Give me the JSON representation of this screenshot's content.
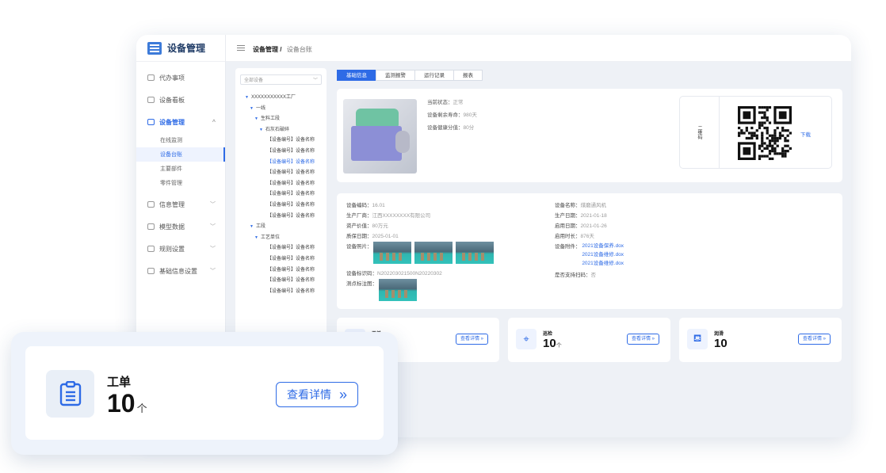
{
  "app": {
    "title": "设备管理"
  },
  "breadcrumb": {
    "parent": "设备管理 /",
    "current": "设备台账"
  },
  "sidebar": {
    "items": [
      {
        "label": "代办事项",
        "icon": "calendar-icon"
      },
      {
        "label": "设备看板",
        "icon": "board-icon"
      },
      {
        "label": "设备管理",
        "icon": "device-icon",
        "chevron": "^"
      },
      {
        "label": "信息管理",
        "icon": "info-icon",
        "chevron": "﹀"
      },
      {
        "label": "模型数据",
        "icon": "model-icon",
        "chevron": "﹀"
      },
      {
        "label": "规则设置",
        "icon": "rule-icon",
        "chevron": "﹀"
      },
      {
        "label": "基础信息设置",
        "icon": "settings-icon",
        "chevron": "﹀"
      }
    ],
    "sub_items": [
      {
        "label": "在线监测"
      },
      {
        "label": "设备台账"
      },
      {
        "label": "主要部件"
      },
      {
        "label": "零件管理"
      }
    ]
  },
  "tree": {
    "select_placeholder": "全部设备",
    "select_chevron": "﹀",
    "nodes": [
      {
        "label": "XXXXXXXXXXX工厂",
        "tri": "▼"
      },
      {
        "label": "一线",
        "tri": "▼"
      },
      {
        "label": "生料工段",
        "tri": "▼"
      },
      {
        "label": "石灰石破碎",
        "tri": "▼"
      },
      {
        "label": "【设备编号】设备名称"
      },
      {
        "label": "【设备编号】设备名称"
      },
      {
        "label": "【设备编号】设备名称"
      },
      {
        "label": "【设备编号】设备名称"
      },
      {
        "label": "【设备编号】设备名称"
      },
      {
        "label": "【设备编号】设备名称"
      },
      {
        "label": "【设备编号】设备名称"
      },
      {
        "label": "【设备编号】设备名称"
      },
      {
        "label": "工段",
        "tri": "▼"
      },
      {
        "label": "工艺单位",
        "tri": "▼"
      },
      {
        "label": "【设备编号】设备名称"
      },
      {
        "label": "【设备编号】设备名称"
      },
      {
        "label": "【设备编号】设备名称"
      },
      {
        "label": "【设备编号】设备名称"
      },
      {
        "label": "【设备编号】设备名称"
      }
    ]
  },
  "tabs": [
    "基础信息",
    "监测报警",
    "运行记录",
    "报表"
  ],
  "device_status": {
    "lines": [
      {
        "label": "当前状态：",
        "value": "正常"
      },
      {
        "label": "设备剩余寿命：",
        "value": "980天"
      },
      {
        "label": "设备健康分值：",
        "value": "80分"
      }
    ]
  },
  "qr": {
    "label": "二维码",
    "download": "下载"
  },
  "info": {
    "left": [
      {
        "label": "设备编码：",
        "value": "16.01"
      },
      {
        "label": "生产厂商：",
        "value": "江西XXXXXXXX有限公司"
      },
      {
        "label": "资产价值：",
        "value": "80万元"
      },
      {
        "label": "质保日期：",
        "value": "2025-01-01"
      }
    ],
    "photos_label": "设备照片：",
    "rfid": {
      "label": "设备标识码：",
      "value": "N202203021500N20220302"
    },
    "point_label": "测点标注图：",
    "right": [
      {
        "label": "设备名称：",
        "value": "煤磨通风机"
      },
      {
        "label": "生产日期：",
        "value": "2021-01-18"
      },
      {
        "label": "启用日期：",
        "value": "2021-01-26"
      },
      {
        "label": "启用时长：",
        "value": "876天"
      }
    ],
    "attach_label": "设备附件：",
    "attachments": [
      "2021设备保养.dox",
      "2021设备维修.dox",
      "2021设备维修.dox"
    ],
    "support": {
      "label": "是否支持扫码：",
      "value": "否"
    }
  },
  "stats": [
    {
      "title": "工单",
      "value": "10",
      "unit": "个",
      "icon": "clipboard-icon",
      "button": "查看详情",
      "arrow": "»"
    },
    {
      "title": "巡检",
      "value": "10",
      "unit": "个",
      "icon": "location-pin-icon",
      "button": "查看详情",
      "arrow": "»"
    },
    {
      "title": "润滑",
      "value": "10",
      "unit": "",
      "icon": "oil-bottle-icon",
      "button": "查看详情",
      "arrow": "»"
    }
  ],
  "floating": {
    "title": "工单",
    "value": "10",
    "unit": "个",
    "button": "查看详情",
    "arrow": "»",
    "icon": "clipboard-icon"
  },
  "colors": {
    "accent": "#2e6be6",
    "frame_bg": "#eef1f6"
  }
}
